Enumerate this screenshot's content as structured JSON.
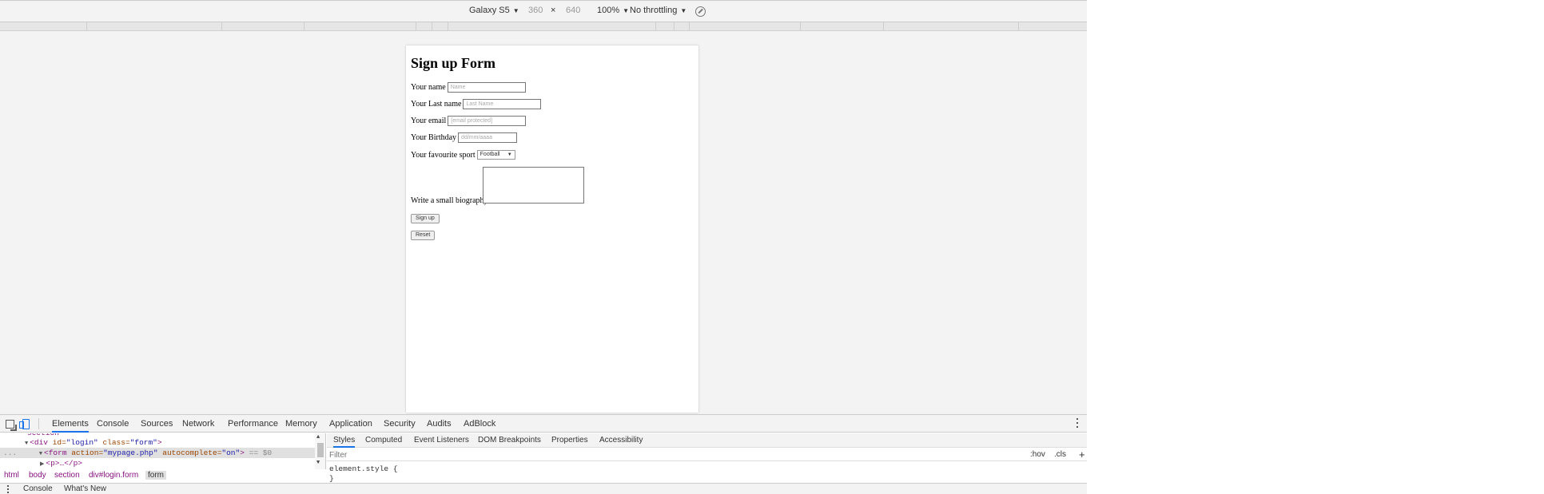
{
  "device_toolbar": {
    "device": "Galaxy S5",
    "width": "360",
    "times": "×",
    "height": "640",
    "zoom": "100%",
    "throttling": "No throttling",
    "caret": "▼"
  },
  "page": {
    "title": "Sign up Form",
    "name_label": "Your name",
    "name_placeholder": "Name",
    "lastname_label": "Your Last name",
    "lastname_placeholder": "Last Name",
    "email_label": "Your email",
    "email_placeholder": "[email protected]",
    "birthday_label": "Your Birthday",
    "birthday_placeholder": "dd/mm/aaaa",
    "sport_label": "Your favourite sport",
    "sport_value": "Football",
    "bio_label": "Write a small biography",
    "signup_button": "Sign up",
    "reset_button": "Reset"
  },
  "devtools": {
    "tabs": [
      "Elements",
      "Console",
      "Sources",
      "Network",
      "Performance",
      "Memory",
      "Application",
      "Security",
      "Audits",
      "AdBlock"
    ],
    "active_tab": "Elements",
    "elements": {
      "line0": "section",
      "line1_tag_open": "<div",
      "line1_attr1": "id=",
      "line1_val1": "\"login\"",
      "line1_attr2": "class=",
      "line1_val2": "\"form\"",
      "line1_close": ">",
      "line2_tag_open": "<form",
      "line2_attr1": "action=",
      "line2_val1": "\"mypage.php\"",
      "line2_attr2": "autocomplete=",
      "line2_val2": "\"on\"",
      "line2_close": ">",
      "line2_eq": "== $0",
      "line3": "<p>…</p>",
      "gutter": "..."
    },
    "breadcrumb": [
      "html",
      "body",
      "section",
      "div#login.form",
      "form"
    ],
    "styles_tabs": [
      "Styles",
      "Computed",
      "Event Listeners",
      "DOM Breakpoints",
      "Properties",
      "Accessibility"
    ],
    "filter_placeholder": "Filter",
    "hov": ":hov",
    "cls": ".cls",
    "plus": "+",
    "style_rule": "element.style {",
    "style_close": "}",
    "drawer_tabs": [
      "Console",
      "What's New"
    ]
  }
}
